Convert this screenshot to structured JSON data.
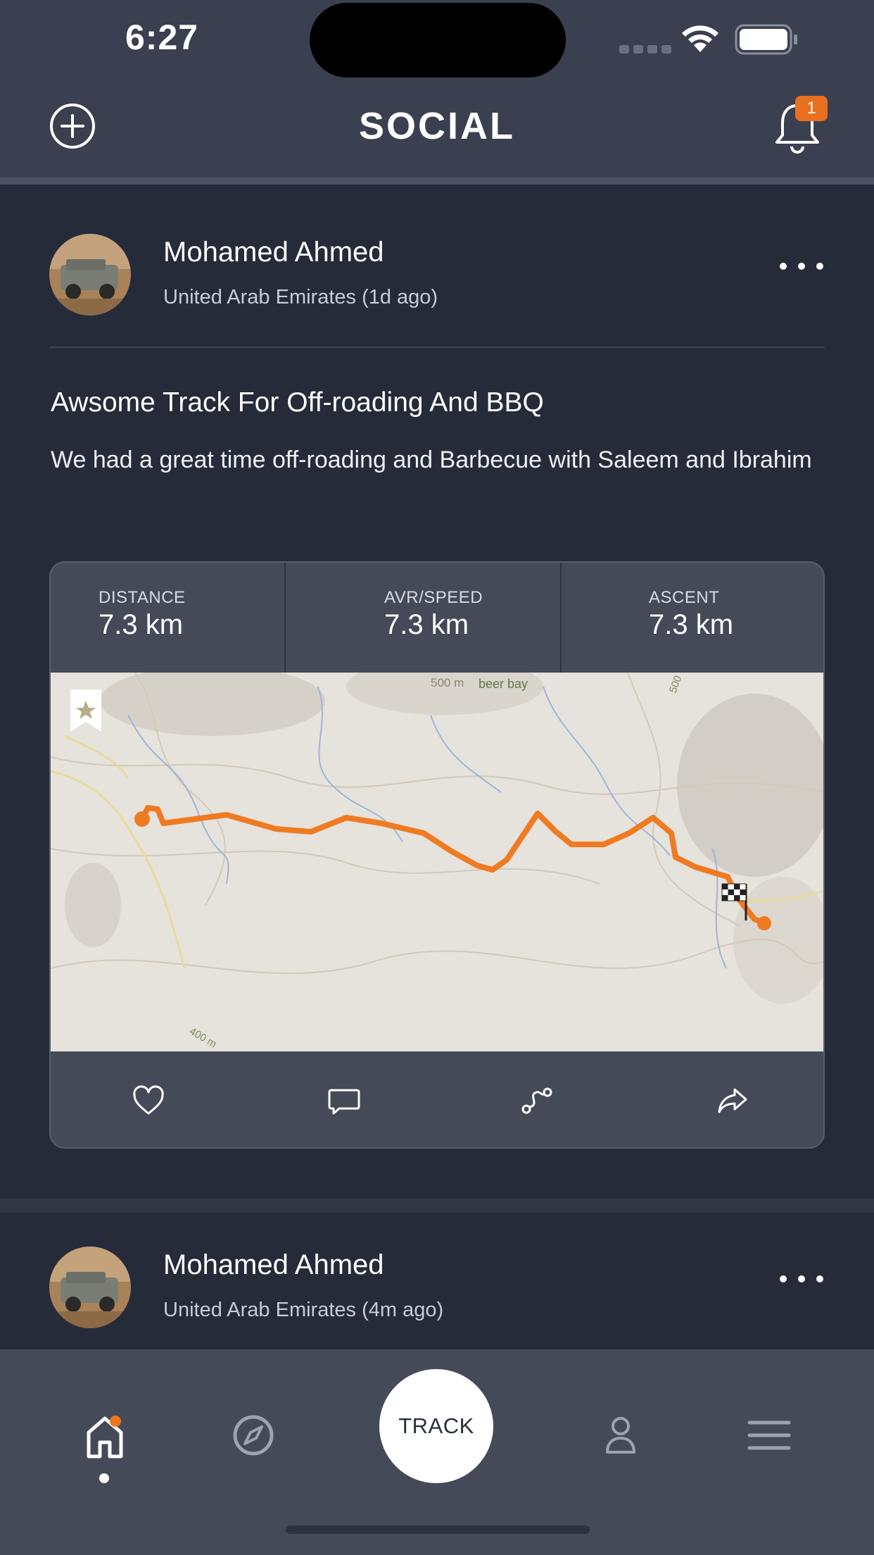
{
  "status_bar": {
    "time": "6:27"
  },
  "header": {
    "title": "SOCIAL",
    "notification_count": "1"
  },
  "posts": [
    {
      "author": "Mohamed Ahmed",
      "meta": "United Arab Emirates (1d ago)",
      "title": "Awsome Track For Off-roading And BBQ",
      "body": "We had a great time off-roading and Barbecue with Saleem and Ibrahim",
      "stats": [
        {
          "label": "DISTANCE",
          "value": "7.3 km"
        },
        {
          "label": "AVR/SPEED",
          "value": "7.3 km"
        },
        {
          "label": "ASCENT",
          "value": "7.3 km"
        }
      ],
      "map_labels": {
        "contour_top": "500 m",
        "place": "beer bay",
        "contour_right": "500",
        "contour_bottom": "400 m"
      }
    },
    {
      "author": "Mohamed Ahmed",
      "meta": "United Arab Emirates (4m ago)"
    }
  ],
  "post_actions": [
    "heart-icon",
    "comment-icon",
    "route-icon",
    "share-icon"
  ],
  "bottom_nav": {
    "items": [
      "home-icon",
      "compass-icon",
      "track",
      "profile-icon",
      "menu-icon"
    ],
    "track_label": "TRACK"
  },
  "colors": {
    "background": "#262b39",
    "header": "#3a4050",
    "card": "#454a59",
    "accent": "#e8701f",
    "route": "#f07a22"
  }
}
